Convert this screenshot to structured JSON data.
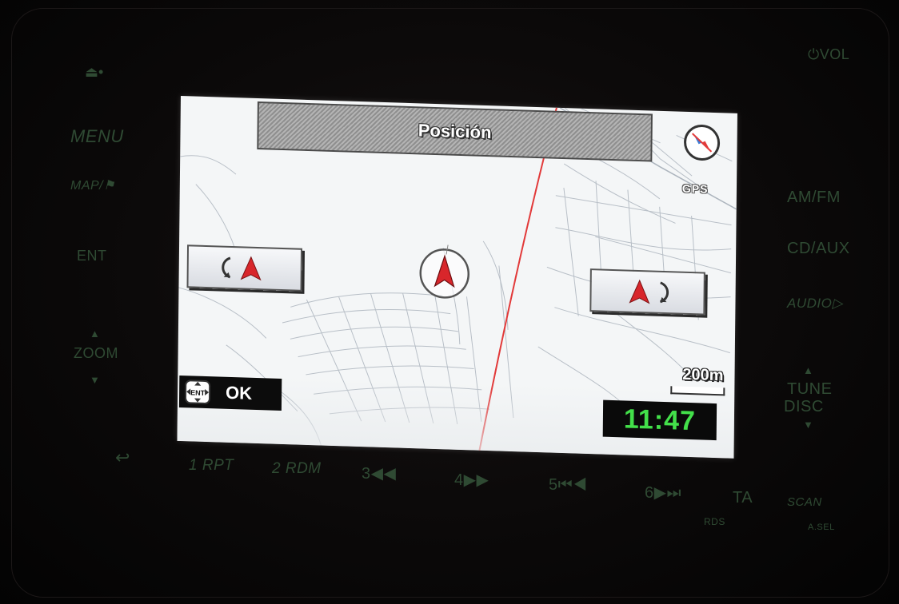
{
  "screen": {
    "title": "Posición",
    "gps_label": "GPS",
    "scale_label": "200m",
    "ok_label": "OK",
    "ent_label": "ENT",
    "clock": "11:47"
  },
  "panel": {
    "left": {
      "menu": "MENU",
      "map": "MAP/",
      "ent": "ENT",
      "zoom": "ZOOM"
    },
    "right": {
      "vol": "VOL",
      "amfm": "AM/FM",
      "cdaux": "CD/AUX",
      "audio": "AUDIO",
      "tune": "TUNE",
      "disc": "DISC"
    },
    "bottom": {
      "preset1": "1 RPT",
      "preset2": "2 RDM",
      "preset3": "3",
      "preset4": "4",
      "preset5": "5",
      "preset6": "6",
      "ta": "TA",
      "rds": "RDS",
      "scan": "SCAN",
      "asel": "A.SEL"
    }
  },
  "colors": {
    "route_line": "#e23a3a",
    "arrow_red": "#d8262b",
    "clock_green": "#43e04a",
    "panel_label": "#2f4a33"
  }
}
